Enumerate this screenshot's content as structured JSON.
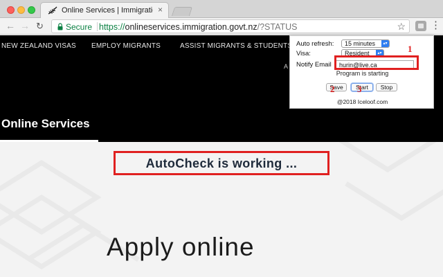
{
  "browser": {
    "tab_title": "Online Services | Immigration N",
    "tab_close": "×",
    "secure_label": "Secure",
    "url_scheme": "https://",
    "url_host": "onlineservices.immigration.govt.nz",
    "url_path": "/?STATUS",
    "star_icon": "☆",
    "menu_icon": "⋮"
  },
  "site": {
    "nav": [
      "NEW ZEALAND VISAS",
      "EMPLOY MIGRANTS",
      "ASSIST MIGRANTS & STUDENTS"
    ],
    "nav_overflow": "A",
    "hero_title": "Online Services",
    "status_message": "AutoCheck is working ...",
    "apply_heading": "Apply online"
  },
  "popup": {
    "auto_refresh_label": "Auto refresh:",
    "auto_refresh_value": "15 minutes",
    "visa_label": "Visa:",
    "visa_value": "Resident",
    "email_label": "Notify Email",
    "email_value": "hurin@live.ca",
    "status": "Program is starting",
    "save_label": "Save",
    "start_label": "Start",
    "stop_label": "Stop",
    "copyright": "@2018 Iceloof.com",
    "accent_color": "#2f7ef1"
  },
  "annotations": {
    "numbers": [
      "1",
      "2",
      "3"
    ],
    "color": "#e02020"
  }
}
